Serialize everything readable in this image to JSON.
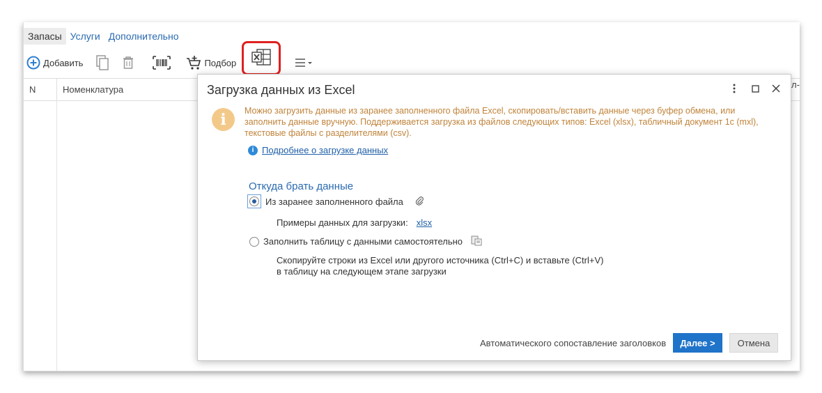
{
  "tabs": [
    "Запасы",
    "Услуги",
    "Дополнительно"
  ],
  "toolbar": {
    "add_label": "Добавить",
    "pick_label": "Подбор",
    "icons": [
      "add-circle-icon",
      "copy-icon",
      "trash-icon",
      "barcode-icon",
      "cart-add-icon",
      "excel-icon",
      "menu-icon"
    ]
  },
  "grid": {
    "columns": [
      "N",
      "Номенклатура",
      "л-"
    ]
  },
  "dialog": {
    "title": "Загрузка данных из Excel",
    "info": "Можно загрузить данные из заранее заполненного файла Excel, скопировать/вставить данные через буфер обмена, или заполнить данные вручную. Поддерживается загрузка из файлов следующих типов: Excel (xlsx), табличный документ 1с (mxl), текстовые файлы с разделителями (csv).",
    "more_link": "Подробнее о загрузке данных",
    "section_title": "Откуда брать данные",
    "option_file": "Из заранее заполненного файла",
    "sample_label": "Примеры данных для загрузки:",
    "sample_link": "xlsx",
    "option_manual": "Заполнить таблицу с данными самостоятельно",
    "hint_line1": "Скопируйте строки из Excel или другого источника (Ctrl+C) и вставьте (Ctrl+V)",
    "hint_line2": "в таблицу на следующем этапе загрузки",
    "auto_match": "Автоматического сопоставление заголовков",
    "next_button": "Далее >",
    "cancel_button": "Отмена"
  },
  "colors": {
    "accent": "#1f73c9",
    "link": "#2a6ab0",
    "info_text": "#c0833a",
    "highlight": "#e02020"
  }
}
